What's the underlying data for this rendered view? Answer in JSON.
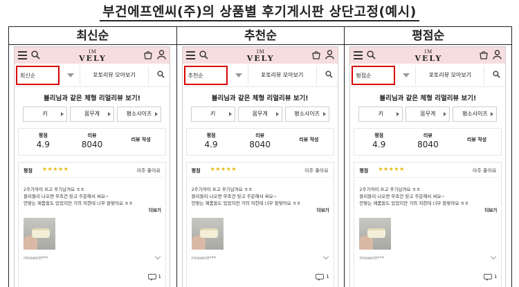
{
  "page_title": "부건에프엔씨(주)의 상품별 후기게시판 상단고정(예시)",
  "columns": [
    {
      "header": "최신순",
      "sort_label": "최신순",
      "photo_link": "포토리뷰 모아보기",
      "section_title": "블리님과 같은 체형 리얼리뷰 보기!",
      "chips": [
        "키",
        "몸무게",
        "평소사이즈"
      ],
      "stats": {
        "rating_label": "평점",
        "rating_value": "4.9",
        "review_label": "리뷰",
        "review_value": "8040",
        "write_label": "리뷰 작성"
      },
      "review": {
        "label": "평점",
        "stars": "★★★★★",
        "rating_text": "아주 좋아요",
        "line1": "2주가까이 쓰고 후기남겨요 ㅎㅎ",
        "line2": "블리블리 나오면 무조건 믿고 주문해서 써요~",
        "line3": "안맞는 제품들도 있었지만 거의 저한테 너무 잘맞아요 ㅎㅎ",
        "more": "더보기",
        "user": "rmswn0***",
        "comments": "1"
      }
    },
    {
      "header": "추천순",
      "sort_label": "추천순",
      "photo_link": "포토리뷰 모아보기",
      "section_title": "블리님과 같은 체형 리얼리뷰 보기!",
      "chips": [
        "키",
        "몸무게",
        "평소사이즈"
      ],
      "stats": {
        "rating_label": "평점",
        "rating_value": "4.9",
        "review_label": "리뷰",
        "review_value": "8040",
        "write_label": "리뷰 작성"
      },
      "review": {
        "label": "평점",
        "stars": "★★★★★",
        "rating_text": "아주 좋아요",
        "line1": "2주가까이 쓰고 후기남겨요 ㅎㅎ",
        "line2": "블리블리 나오면 무조건 믿고 주문해서 써요~",
        "line3": "안맞는 제품들도 있었지만 거의 저한테 너무 잘맞아요 ㅎㅎ",
        "more": "더보기",
        "user": "rmswn0***",
        "comments": "1"
      }
    },
    {
      "header": "평점순",
      "sort_label": "평점순",
      "photo_link": "포토리뷰 모아보기",
      "section_title": "블리님과 같은 체형 리얼리뷰 보기!",
      "chips": [
        "키",
        "몸무게",
        "평소사이즈"
      ],
      "stats": {
        "rating_label": "평점",
        "rating_value": "4.9",
        "review_label": "리뷰",
        "review_value": "8040",
        "write_label": "리뷰 작성"
      },
      "review": {
        "label": "평점",
        "stars": "★★★★★",
        "rating_text": "아주 좋아요",
        "line1": "2주가까이 쓰고 후기남겨요 ㅎㅎ",
        "line2": "블리블리 나오면 무조건 믿고 주문해서 써요~",
        "line3": "안맞는 제품들도 있었지만 거의 저한테 너무 잘맞아요 ㅎㅎ",
        "more": "더보기",
        "user": "rmswn0***",
        "comments": "1"
      }
    }
  ],
  "brand": {
    "logo_line1": "IM",
    "logo_line2": "VELY"
  },
  "icons": {
    "menu": "hamburger-icon",
    "search": "search-icon",
    "cart": "shopping-bag-icon",
    "account": "user-icon",
    "dropdown": "chevron-down-icon",
    "comment": "comment-icon"
  },
  "colors": {
    "header_bg": "#f7dede",
    "highlight_border": "#d80000",
    "star": "#e6b800"
  }
}
